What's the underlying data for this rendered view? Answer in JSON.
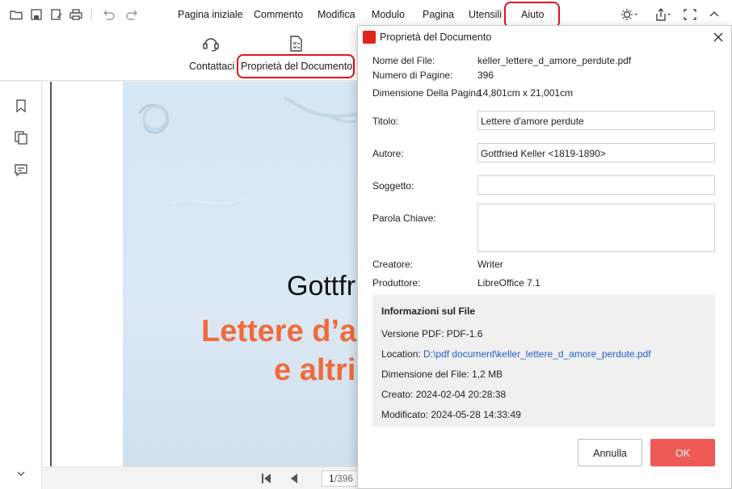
{
  "menu": {
    "items": [
      "Pagina iniziale",
      "Commento",
      "Modifica",
      "Modulo",
      "Pagina",
      "Utensili",
      "Aiuto"
    ],
    "active": "Aiuto"
  },
  "ribbon": {
    "contact_label": "Contattaci",
    "doc_props_label": "Proprietà del Documento"
  },
  "document": {
    "author_visible": "Gottfri",
    "title_line1_visible": "Lettere d’a",
    "title_line2_visible": "e altri"
  },
  "nav": {
    "current_page": "1",
    "total_pages": "/396"
  },
  "dialog": {
    "title": "Proprietà del Documento",
    "file_name_label": "Nome del File:",
    "file_name": "keller_lettere_d_amore_perdute.pdf",
    "pages_label": "Numero di Pagine:",
    "pages": "396",
    "page_size_label": "Dimensione Della Pagina",
    "page_size": "14,801cm x 21,001cm",
    "title_label": "Titolo:",
    "title_value": "Lettere d'amore perdute",
    "author_label": "Autore:",
    "author_value": "Gottfried Keller <1819-1890>",
    "subject_label": "Soggetto:",
    "subject_value": "",
    "keywords_label": "Parola Chiave:",
    "keywords_value": "",
    "creator_label": "Creatore:",
    "creator_value": "Writer",
    "producer_label": "Produttore:",
    "producer_value": "LibreOffice 7.1",
    "file_info": {
      "heading": "Informazioni sul File",
      "pdf_version": "Versione PDF: PDF-1.6",
      "location_label": "Location:",
      "location_value": "D:\\pdf document\\keller_lettere_d_amore_perdute.pdf",
      "file_size": "Dimensione del File: 1,2 MB",
      "created": "Creato: 2024-02-04 20:28:38",
      "modified": "Modificato: 2024-05-28 14:33:49"
    },
    "cancel_label": "Annulla",
    "ok_label": "OK"
  },
  "colors": {
    "highlight_ring": "#e0131a",
    "ok_button": "#ef5a55",
    "link": "#1e60c9",
    "doc_title": "#f26a3a"
  }
}
